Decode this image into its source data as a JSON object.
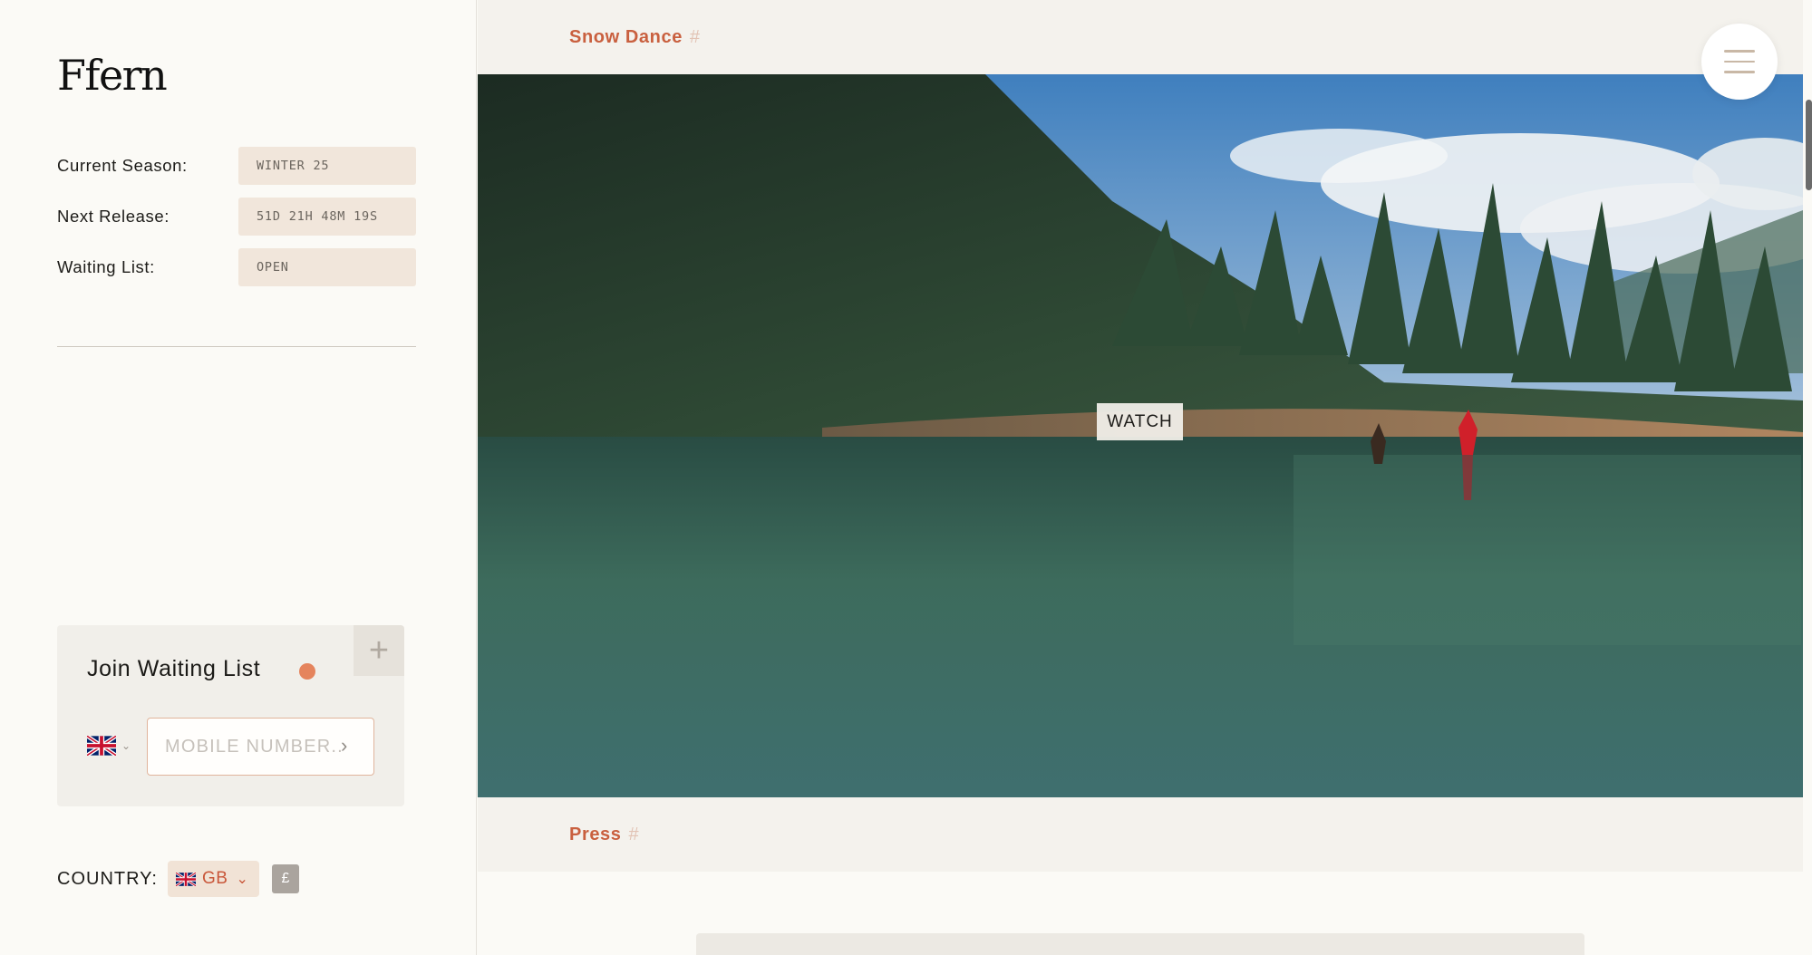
{
  "sidebar": {
    "logo": "Ffern",
    "info": [
      {
        "label": "Current Season:",
        "value": "WINTER 25"
      },
      {
        "label": "Next Release:",
        "value": "51D 21H 48M 19S"
      },
      {
        "label": "Waiting List:",
        "value": "OPEN"
      }
    ],
    "waiting_list": {
      "title": "Join Waiting List",
      "plus": "+",
      "country_flag": "uk-flag-icon",
      "chevron": "⌄",
      "mobile_placeholder": "MOBILE NUMBER...",
      "arrow": "›",
      "status_dot_color": "#e5845d"
    },
    "country": {
      "label": "COUNTRY:",
      "selected": "GB",
      "chevron": "⌄",
      "currency": "£"
    }
  },
  "main": {
    "sections": [
      {
        "title": "Snow Dance",
        "hash": "#"
      },
      {
        "title": "Press",
        "hash": "#"
      }
    ],
    "hero": {
      "watch_label": "WATCH"
    }
  },
  "colors": {
    "accent": "#c9603f",
    "value_bg": "#f1e6db",
    "page_bg": "#fbfaf6"
  }
}
